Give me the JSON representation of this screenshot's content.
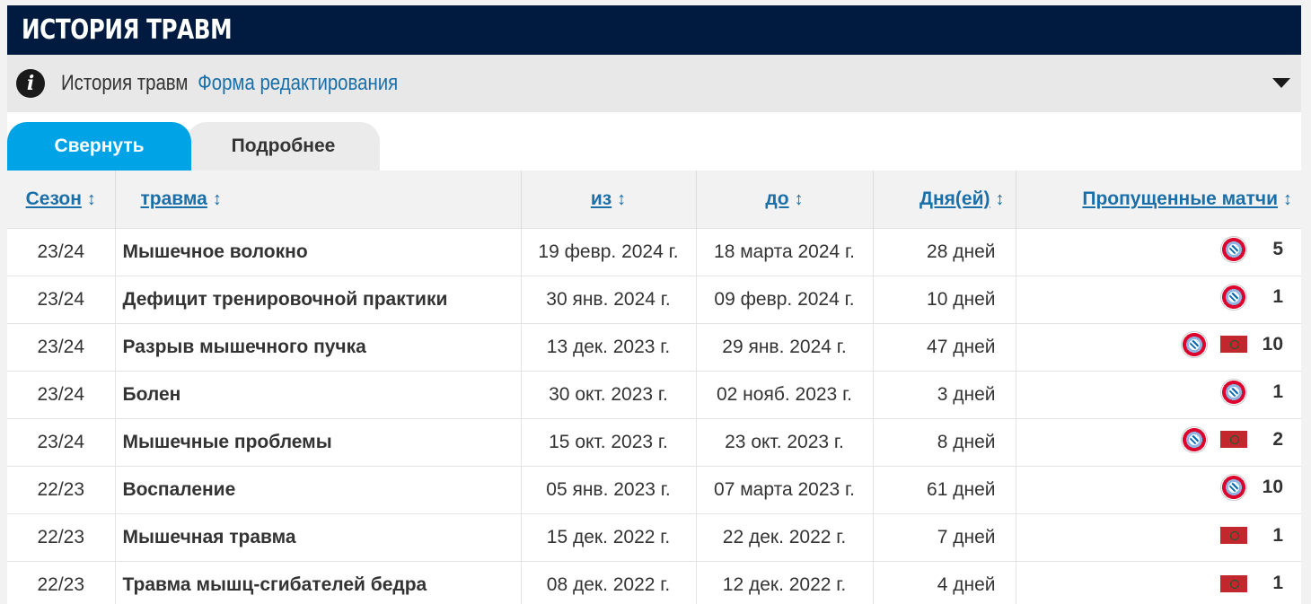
{
  "header": {
    "title": "ИСТОРИЯ ТРАВМ"
  },
  "info_bar": {
    "text": "История травм",
    "link": "Форма редактирования"
  },
  "tabs": [
    {
      "label": "Свернуть",
      "active": true
    },
    {
      "label": "Подробнее",
      "active": false
    }
  ],
  "table": {
    "columns": [
      "Сезон",
      "травма",
      "из",
      "до",
      "Дня(ей)",
      "Пропущенные матчи"
    ],
    "rows": [
      {
        "season": "23/24",
        "injury": "Мышечное волокно",
        "from": "19 февр. 2024 г.",
        "until": "18 марта 2024 г.",
        "days": "28 дней",
        "icons": [
          "crest"
        ],
        "missed": "5"
      },
      {
        "season": "23/24",
        "injury": "Дефицит тренировочной практики",
        "from": "30 янв. 2024 г.",
        "until": "09 февр. 2024 г.",
        "days": "10 дней",
        "icons": [
          "crest"
        ],
        "missed": "1"
      },
      {
        "season": "23/24",
        "injury": "Разрыв мышечного пучка",
        "from": "13 дек. 2023 г.",
        "until": "29 янв. 2024 г.",
        "days": "47 дней",
        "icons": [
          "crest",
          "flag"
        ],
        "missed": "10"
      },
      {
        "season": "23/24",
        "injury": "Болен",
        "from": "30 окт. 2023 г.",
        "until": "02 нояб. 2023 г.",
        "days": "3 дней",
        "icons": [
          "crest"
        ],
        "missed": "1"
      },
      {
        "season": "23/24",
        "injury": "Мышечные проблемы",
        "from": "15 окт. 2023 г.",
        "until": "23 окт. 2023 г.",
        "days": "8 дней",
        "icons": [
          "crest",
          "flag"
        ],
        "missed": "2"
      },
      {
        "season": "22/23",
        "injury": "Воспаление",
        "from": "05 янв. 2023 г.",
        "until": "07 марта 2023 г.",
        "days": "61 дней",
        "icons": [
          "crest"
        ],
        "missed": "10"
      },
      {
        "season": "22/23",
        "injury": "Мышечная травма",
        "from": "15 дек. 2022 г.",
        "until": "22 дек. 2022 г.",
        "days": "7 дней",
        "icons": [
          "flag"
        ],
        "missed": "1"
      },
      {
        "season": "22/23",
        "injury": "Травма мышц-сгибателей бедра",
        "from": "08 дек. 2022 г.",
        "until": "12 дек. 2022 г.",
        "days": "4 дней",
        "icons": [
          "flag"
        ],
        "missed": "1"
      }
    ]
  },
  "colors": {
    "header_bg": "#001a40",
    "tab_active": "#00a3e6",
    "link": "#1a6fa8"
  },
  "icon_names": {
    "crest": "club-crest-icon",
    "flag": "country-flag-icon"
  }
}
